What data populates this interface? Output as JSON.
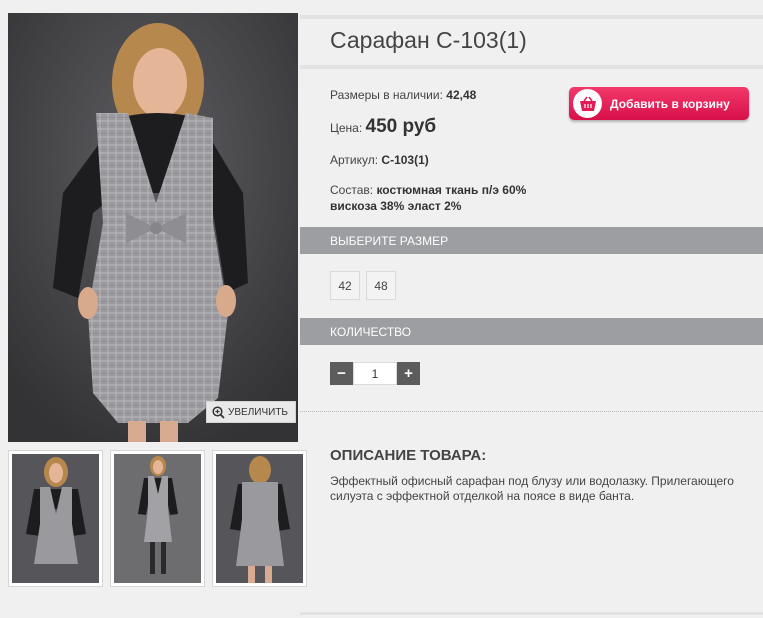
{
  "product": {
    "title": "Сарафан С-103(1)",
    "sizes_label": "Размеры в наличии:",
    "sizes_value": "42,48",
    "price_label": "Цена:",
    "price_value": "450 руб",
    "sku_label": "Артикул:",
    "sku_value": "С-103(1)",
    "composition_label": "Состав:",
    "composition_line1": "костюмная ткань п/э 60%",
    "composition_line2": "вискоза 38% эласт 2%"
  },
  "cart_button": {
    "label": "Добавить в корзину",
    "icon": "basket-icon",
    "color": "#e21c56"
  },
  "zoom_button": {
    "label": "УВЕЛИЧИТЬ",
    "icon": "zoom-in-icon"
  },
  "size_section": {
    "label": "ВЫБЕРИТЕ РАЗМЕР",
    "options": [
      "42",
      "48"
    ]
  },
  "quantity_section": {
    "label": "КОЛИЧЕСТВО",
    "minus": "−",
    "plus": "+",
    "value": "1"
  },
  "description": {
    "title": "ОПИСАНИЕ ТОВАРА:",
    "text": "Эффектный офисный сарафан под блузу или водолазку. Прилегающего силуэта с эффектной отделкой на поясе в виде банта."
  },
  "colors": {
    "section_bar": "#9c9ea2",
    "accent": "#e21c56",
    "background": "#f0f0f0"
  }
}
